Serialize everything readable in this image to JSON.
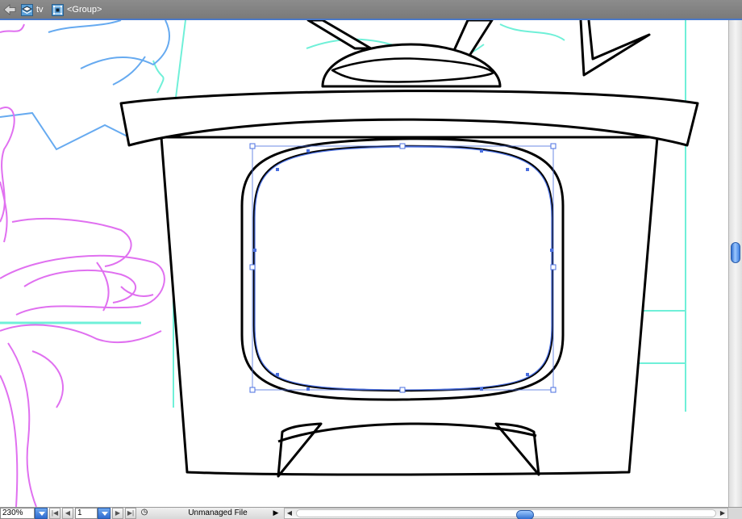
{
  "isolation_bar": {
    "back_icon": "back-arrow-icon",
    "layer_name": "tv",
    "layer_icon": "layer-icon",
    "group_name": "<Group>",
    "group_icon": "group-icon",
    "highlight_color": "#4a78c8"
  },
  "artwork": {
    "stroke_color": "#000000",
    "selection_color": "#4a6fe0",
    "sketch_colors": {
      "magenta": "#e070f0",
      "cyan": "#6ff0d8",
      "blue": "#66aaf0"
    },
    "selected_object": "tv-screen-path"
  },
  "statusbar": {
    "zoom": "230%",
    "page": "1",
    "status_icon": "status-clock-icon",
    "status_text": "Unmanaged File",
    "status_menu_icon": "triangle-right-icon"
  }
}
